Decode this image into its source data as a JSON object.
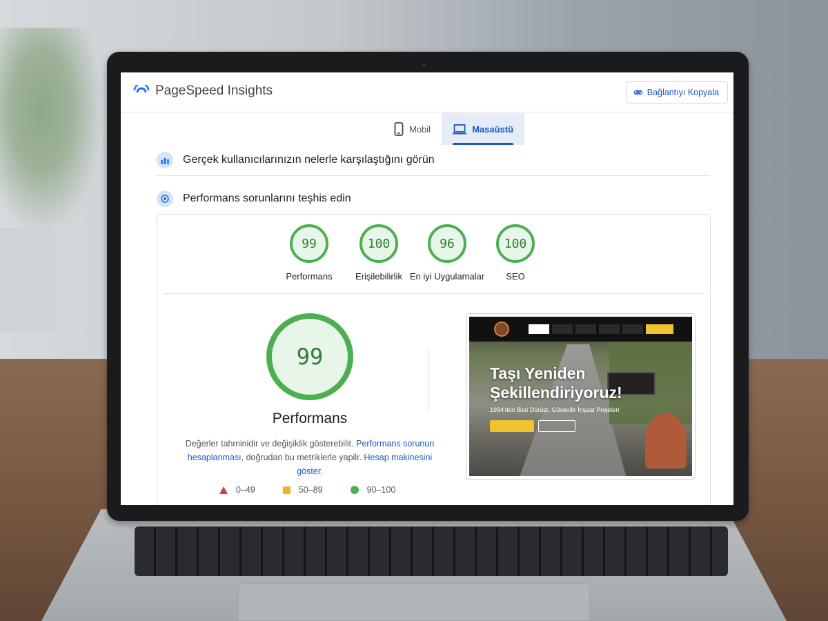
{
  "app": {
    "title": "PageSpeed Insights",
    "copy_link_label": "Bağlantıyı Kopyala"
  },
  "tabs": [
    {
      "label": "Mobil",
      "icon": "phone-icon",
      "active": false
    },
    {
      "label": "Masaüstü",
      "icon": "laptop-icon",
      "active": true
    }
  ],
  "sections": {
    "real_users": "Gerçek kullanıcılarınızın nelerle karşılaştığını görün",
    "diagnose": "Performans sorunlarını teşhis edin"
  },
  "scores": [
    {
      "value": "99",
      "label": "Performans"
    },
    {
      "value": "100",
      "label": "Erişilebilirlik"
    },
    {
      "value": "96",
      "label": "En iyi Uygulamalar"
    },
    {
      "value": "100",
      "label": "SEO"
    }
  ],
  "performance": {
    "score": "99",
    "label": "Performans",
    "desc_text": "Değerler tahminidir ve değişiklik gösterebilit.",
    "desc_link1": "Performans sorunun hesaplanması",
    "desc_text2": ", doğrudan bu metriklerle yapilr.",
    "desc_link2": "Hesap makinesini göster."
  },
  "legend": [
    {
      "range": "0–49",
      "color": "#e53935"
    },
    {
      "range": "50–89",
      "color": "#f0b429"
    },
    {
      "range": "90–100",
      "color": "#4caf50"
    }
  ],
  "screenshot": {
    "headline_line1": "Taşı Yeniden",
    "headline_line2": "Şekillendiriyoruz!",
    "subline": "1994'den Beri Dürüst, Güvenilir İnşaat Projeleri"
  },
  "colors": {
    "accent": "#1a56c4",
    "good": "#4caf50",
    "good_bg": "#e8f5e9"
  }
}
